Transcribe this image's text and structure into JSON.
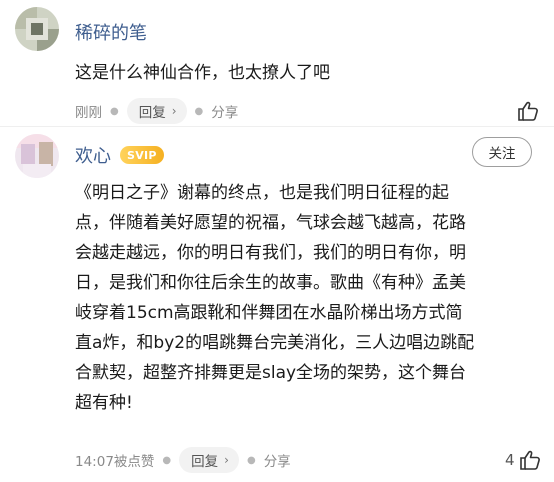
{
  "comments": [
    {
      "username": "稀碎的笔",
      "text": "这是什么神仙合作，也太撩人了吧",
      "time": "刚刚",
      "reply_label": "回复",
      "share_label": "分享",
      "like_count": ""
    },
    {
      "username": "欢心",
      "badge": "SVIP",
      "follow_label": "关注",
      "text_lines": [
        "《明日之子》谢幕的终点，也是我们明日征程的起",
        "点，伴随着美好愿望的祝福，气球会越飞越高，花路",
        "会越走越远，你的明日有我们，我们的明日有你，明",
        "日，是我们和你往后余生的故事。歌曲《有种》孟美",
        "岐穿着15cm高跟靴和伴舞团在水晶阶梯出场方式简",
        "直a炸，和by2的唱跳舞台完美消化，三人边唱边跳配",
        "合默契，超整齐排舞更是slay全场的架势，这个舞台",
        "超有种!"
      ],
      "time": "14:07被点赞",
      "reply_label": "回复",
      "share_label": "分享",
      "like_count": "4"
    }
  ],
  "colors": {
    "username": "#3f5e8f",
    "meta_text": "#8a8a8a",
    "svip_gradient": [
      "#ffd35c",
      "#f5b021"
    ]
  },
  "icons": {
    "chevron": "chevron-right-icon",
    "like": "thumbs-up-icon"
  }
}
